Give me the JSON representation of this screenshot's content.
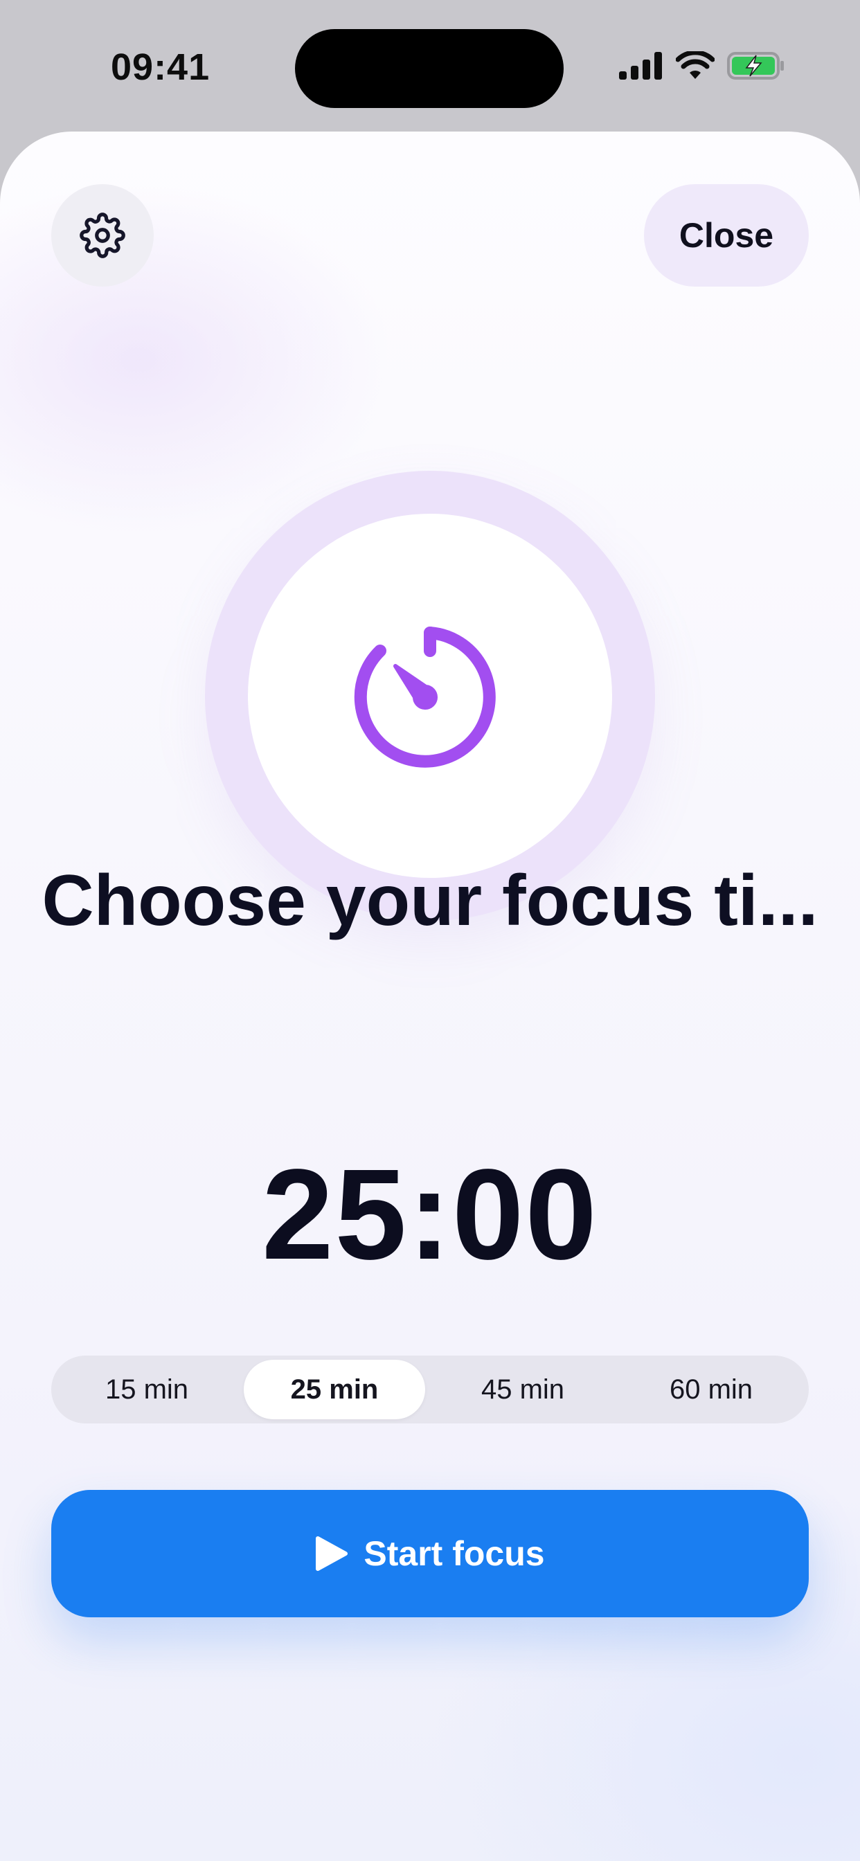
{
  "status_bar": {
    "time": "09:41",
    "icons": [
      "cellular-signal-icon",
      "wifi-icon",
      "battery-charging-icon"
    ],
    "battery_color": "#34c759"
  },
  "header": {
    "settings_icon": "gear-icon",
    "close_label": "Close"
  },
  "hero": {
    "icon": "timer-icon",
    "accent_color": "#a24ef0"
  },
  "headline": "Choose your focus ti...",
  "timer_display": "25:00",
  "durations": {
    "options": [
      "15 min",
      "25 min",
      "45 min",
      "60 min"
    ],
    "selected": "25 min"
  },
  "primary_action": {
    "label": "Start focus",
    "icon": "play-icon",
    "color": "#1a7ef1"
  }
}
